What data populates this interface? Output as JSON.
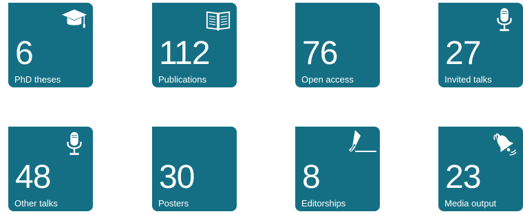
{
  "tiles": [
    {
      "value": "6",
      "label": "PhD theses",
      "icon": "graduation-cap-icon"
    },
    {
      "value": "112",
      "label": "Publications",
      "icon": "open-book-icon"
    },
    {
      "value": "76",
      "label": "Open access",
      "icon": ""
    },
    {
      "value": "27",
      "label": "Invited talks",
      "icon": "microphone-icon"
    },
    {
      "value": "48",
      "label": "Other talks",
      "icon": "microphone-icon"
    },
    {
      "value": "30",
      "label": "Posters",
      "icon": ""
    },
    {
      "value": "8",
      "label": "Editorships",
      "icon": "fountain-pen-icon"
    },
    {
      "value": "23",
      "label": "Media output",
      "icon": "bell-icon"
    }
  ],
  "colors": {
    "tile": "#156f84",
    "text": "#ffffff",
    "background": "#ffffff"
  }
}
